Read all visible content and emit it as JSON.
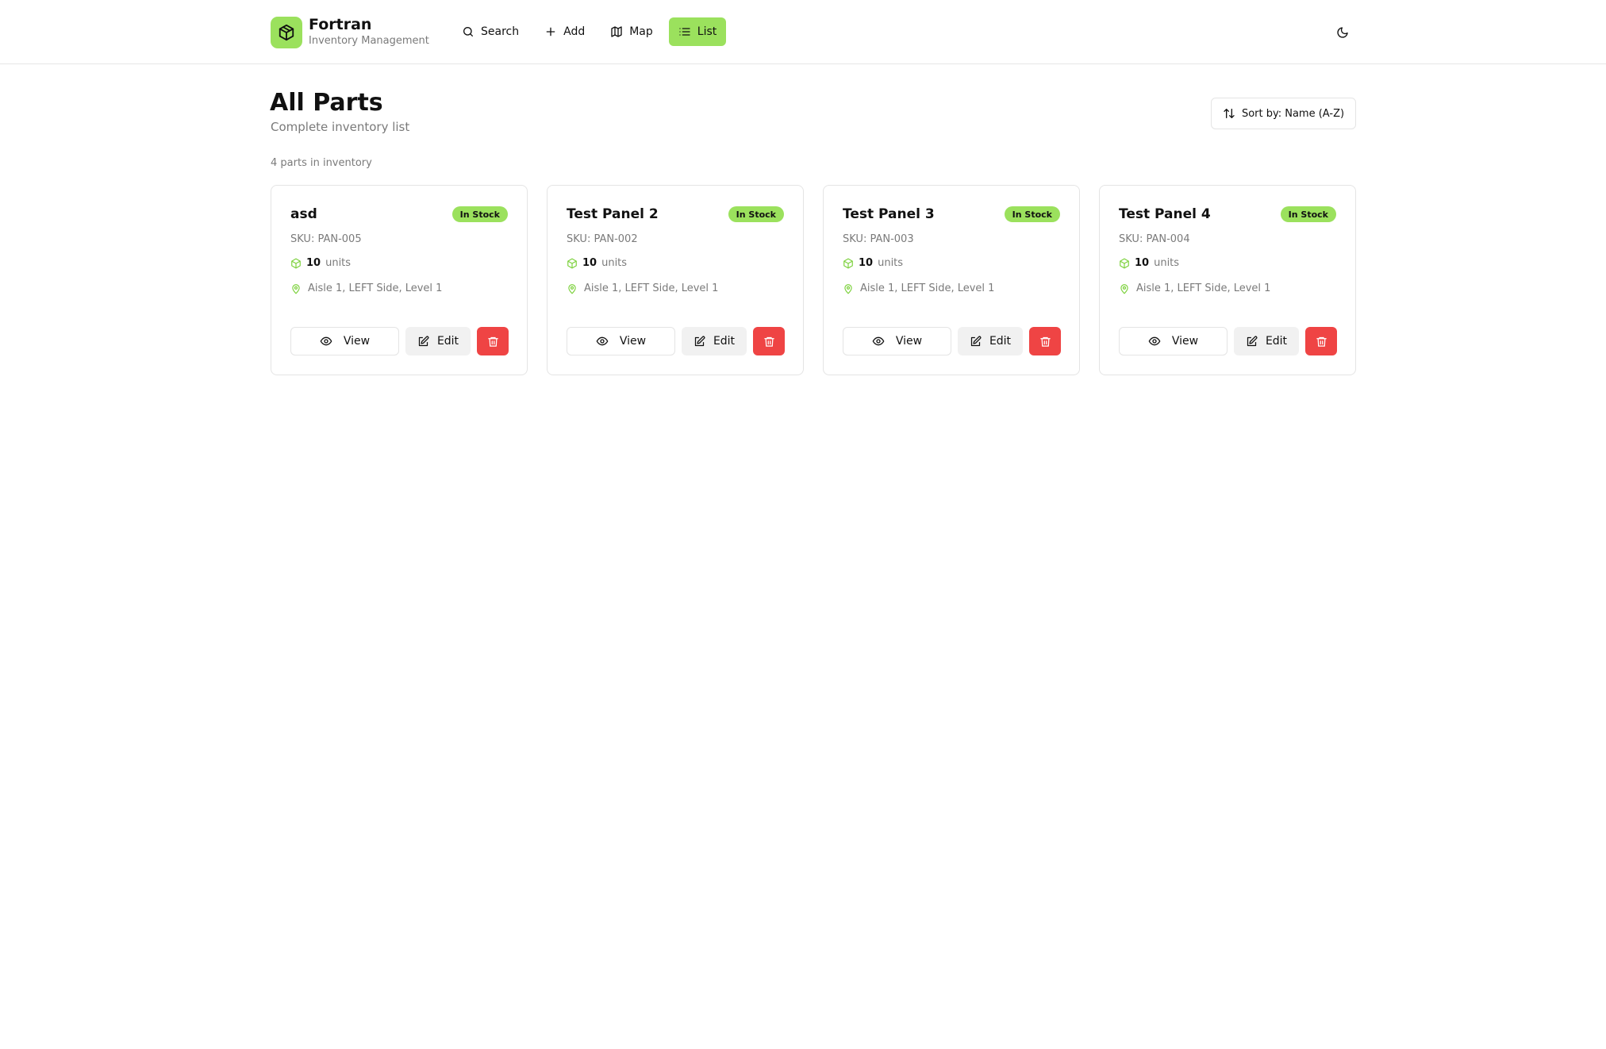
{
  "app": {
    "name": "Fortran",
    "subtitle": "Inventory Management"
  },
  "nav": {
    "search": "Search",
    "add": "Add",
    "map": "Map",
    "list": "List",
    "active": "list"
  },
  "page": {
    "title": "All Parts",
    "subtitle": "Complete inventory list",
    "sort_label": "Sort by: Name (A-Z)",
    "count_text": "4 parts in inventory"
  },
  "colors": {
    "accent": "#9be15d",
    "danger": "#ef4444",
    "muted": "#7a7a7a",
    "border": "#e4e4e4"
  },
  "parts": [
    {
      "name": "asd",
      "status": "In Stock",
      "sku": "SKU: PAN-005",
      "quantity": "10",
      "unit": "units",
      "location": "Aisle 1, LEFT Side, Level 1",
      "view_label": "View",
      "edit_label": "Edit"
    },
    {
      "name": "Test Panel 2",
      "status": "In Stock",
      "sku": "SKU: PAN-002",
      "quantity": "10",
      "unit": "units",
      "location": "Aisle 1, LEFT Side, Level 1",
      "view_label": "View",
      "edit_label": "Edit"
    },
    {
      "name": "Test Panel 3",
      "status": "In Stock",
      "sku": "SKU: PAN-003",
      "quantity": "10",
      "unit": "units",
      "location": "Aisle 1, LEFT Side, Level 1",
      "view_label": "View",
      "edit_label": "Edit"
    },
    {
      "name": "Test Panel 4",
      "status": "In Stock",
      "sku": "SKU: PAN-004",
      "quantity": "10",
      "unit": "units",
      "location": "Aisle 1, LEFT Side, Level 1",
      "view_label": "View",
      "edit_label": "Edit"
    }
  ]
}
